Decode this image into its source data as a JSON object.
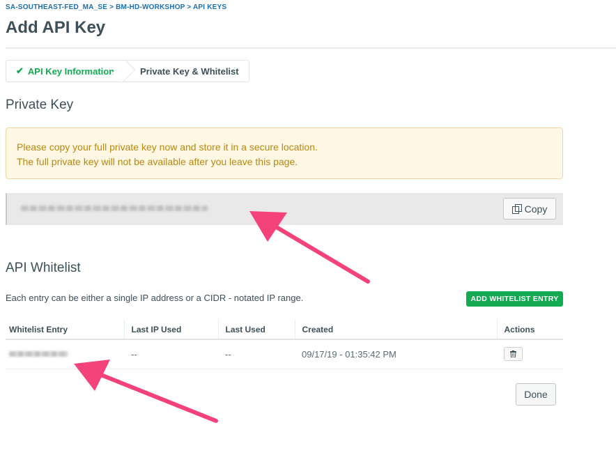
{
  "breadcrumb": {
    "items": [
      "SA-SOUTHEAST-FED_MA_SE",
      "BM-HD-WORKSHOP",
      "API KEYS"
    ],
    "separator": " > "
  },
  "page": {
    "title": "Add API Key"
  },
  "wizard": {
    "steps": [
      {
        "label": "API Key Information",
        "state": "complete",
        "icon": "checkmark-icon"
      },
      {
        "label": "Private Key & Whitelist",
        "state": "active"
      }
    ]
  },
  "private_key": {
    "section_title": "Private Key",
    "alert_line1": "Please copy your full private key now and store it in a secure location.",
    "alert_line2": "The full private key will not be available after you leave this page.",
    "copy_label": "Copy"
  },
  "whitelist": {
    "section_title": "API Whitelist",
    "description": "Each entry can be either a single IP address or a CIDR - notated IP range.",
    "add_button_label": "ADD WHITELIST ENTRY",
    "columns": [
      "Whitelist Entry",
      "Last IP Used",
      "Last Used",
      "Created",
      "Actions"
    ],
    "rows": [
      {
        "last_ip": "--",
        "last_used": "--",
        "created": "09/17/19 - 01:35:42 PM"
      }
    ]
  },
  "footer": {
    "done_label": "Done"
  },
  "colors": {
    "accent_green": "#13aa52",
    "link_blue": "#1a6fb0",
    "alert_text": "#b88811",
    "annotation_pink": "#f4427a"
  }
}
